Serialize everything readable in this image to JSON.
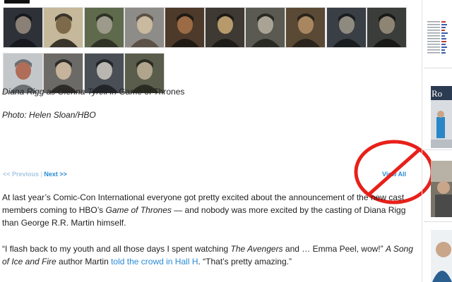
{
  "gallery": {
    "thumbnails": [
      {
        "name": "thumb-1",
        "colors": [
          "#2e3238",
          "#8a8075",
          "#16191e"
        ]
      },
      {
        "name": "thumb-2",
        "colors": [
          "#c6b89a",
          "#7d6a4a",
          "#3a352a"
        ]
      },
      {
        "name": "thumb-3",
        "colors": [
          "#5f6a4d",
          "#9c9a8a",
          "#2f3326"
        ]
      },
      {
        "name": "thumb-4",
        "colors": [
          "#8e8c88",
          "#c9b99f",
          "#5b5147"
        ]
      },
      {
        "name": "thumb-5",
        "colors": [
          "#4d3a2a",
          "#9a6b44",
          "#1f1a14"
        ]
      },
      {
        "name": "thumb-6",
        "colors": [
          "#3e3a33",
          "#b79a6c",
          "#1e1c18"
        ]
      },
      {
        "name": "thumb-7",
        "colors": [
          "#5a5a52",
          "#a8a395",
          "#2a2a24"
        ]
      },
      {
        "name": "thumb-8",
        "colors": [
          "#5a4a35",
          "#a88760",
          "#2a241c"
        ]
      },
      {
        "name": "thumb-9",
        "colors": [
          "#3a3f45",
          "#8f8a80",
          "#1a1d20"
        ]
      },
      {
        "name": "thumb-10",
        "colors": [
          "#3b3d3a",
          "#8d8474",
          "#191a18"
        ]
      },
      {
        "name": "thumb-11",
        "colors": [
          "#c3c7ca",
          "#b06d57",
          "#6a6f73"
        ]
      },
      {
        "name": "thumb-12",
        "colors": [
          "#6c6a66",
          "#c5b49b",
          "#2e2c29"
        ]
      },
      {
        "name": "thumb-13",
        "colors": [
          "#4a4e55",
          "#b9b6b1",
          "#22252a"
        ]
      },
      {
        "name": "thumb-14",
        "colors": [
          "#5a5d4c",
          "#b0a58c",
          "#2a2c22"
        ]
      }
    ]
  },
  "caption": {
    "actor": "Diana Rigg",
    "as_word": " as ",
    "role": "Olenna Tyrell",
    "in_word": " in ",
    "show": "Game of Thrones",
    "photo_credit": "Photo: Helen Sloan/HBO"
  },
  "pager": {
    "previous": "<< Previous",
    "separator": " | ",
    "next": "Next >>",
    "view_all": "View All"
  },
  "overlay": {
    "no_sign_color": "#e8201a"
  },
  "article": {
    "p1": "At last year’s Comic-Con International everyone got pretty excited about the announcement of the new cast members coming to HBO’s ",
    "p1_title": "Game of Thrones",
    "p1_end": " — and nobody was more excited by the casting of Diana Rigg than George R.R. Martin himself.",
    "p2_a": "“I flash back to my youth and all those days I spent watching ",
    "p2_title1": "The Avengers",
    "p2_b": " and … Emma Peel, wow!” ",
    "p2_title2": "A Song of Ice and Fire",
    "p2_c": " author Martin ",
    "p2_link": "told the crowd in Hall H",
    "p2_d": ". “That’s pretty amazing.”"
  },
  "sidebar": {
    "ad_text": "Ro",
    "link_color": "#2a8bd6"
  }
}
